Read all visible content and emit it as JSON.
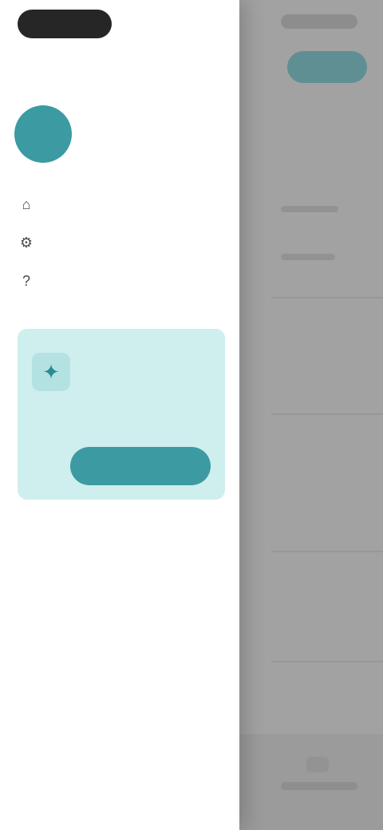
{
  "drawer": {
    "profile": {
      "avatar_initials": "",
      "name": ""
    },
    "menu": [
      {
        "icon": "home-icon",
        "label": ""
      },
      {
        "icon": "settings-icon",
        "label": ""
      },
      {
        "icon": "help-icon",
        "label": ""
      }
    ],
    "promo": {
      "icon": "sparkle-icon",
      "title": "",
      "text": "",
      "button_label": ""
    }
  },
  "background": {
    "top_button_label": "",
    "bottom_nav_label": ""
  },
  "colors": {
    "accent": "#3c9aa2",
    "promo_background": "#cfeeee",
    "drawer_background": "#ffffff",
    "overlay": "#9a9a9a"
  }
}
